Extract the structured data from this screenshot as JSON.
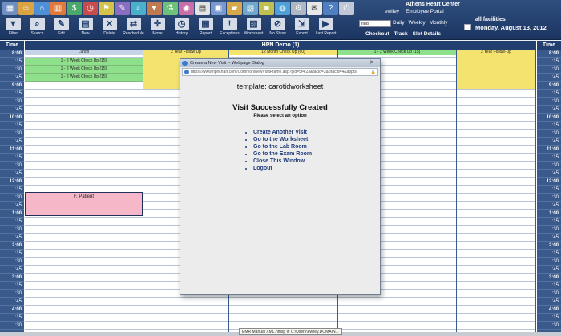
{
  "header": {
    "center_name": "Athens Heart Center",
    "username": "ewiley",
    "portal_link": "Employee Portal",
    "find_value": "find",
    "view_links": [
      "Daily",
      "Weekly",
      "Monthly"
    ],
    "action_links": [
      "Checkout",
      "Track",
      "Slot Details"
    ],
    "facility": "all facilities",
    "date": "Monday, August 13, 2012"
  },
  "top_icons": [
    "calendar-icon",
    "people-icon",
    "home-icon",
    "chart-icon",
    "money-icon",
    "clock-icon",
    "flag-icon",
    "pen-icon",
    "magnify-icon",
    "stethoscope-icon",
    "lab-icon",
    "pill-icon",
    "note-icon",
    "book-icon",
    "folder-icon",
    "photo-icon",
    "camera-icon",
    "globe-icon",
    "gear-icon",
    "mail-icon",
    "help-icon",
    "power-icon"
  ],
  "toolbar": [
    {
      "label": "Filter",
      "glyph": "▼",
      "name": "filter-button"
    },
    {
      "label": "Search",
      "glyph": "⌕",
      "name": "search-button"
    },
    {
      "label": "Edit",
      "glyph": "✎",
      "name": "edit-button"
    },
    {
      "label": "New",
      "glyph": "▤",
      "name": "new-button"
    },
    {
      "label": "Delete",
      "glyph": "✕",
      "name": "delete-button"
    },
    {
      "label": "Reschedule",
      "glyph": "⇄",
      "name": "reschedule-button"
    },
    {
      "label": "Move",
      "glyph": "✛",
      "name": "move-button"
    },
    {
      "label": "History",
      "glyph": "◷",
      "name": "history-button"
    },
    {
      "label": "Report",
      "glyph": "▦",
      "name": "report-button"
    },
    {
      "label": "Exceptions",
      "glyph": "!",
      "name": "exceptions-button"
    },
    {
      "label": "Worksheet",
      "glyph": "▧",
      "name": "worksheet-button"
    },
    {
      "label": "No Show",
      "glyph": "⊘",
      "name": "no-show-button"
    },
    {
      "label": "Export",
      "glyph": "⇲",
      "name": "export-button"
    },
    {
      "label": "Last Report",
      "glyph": "▶",
      "name": "last-report-button"
    }
  ],
  "schedule": {
    "time_header": "Time",
    "provider": "HPN Demo (1)",
    "times": [
      "8:00",
      ":15",
      ":30",
      ":45",
      "9:00",
      ":15",
      ":30",
      ":45",
      "10:00",
      ":15",
      ":30",
      ":45",
      "11:00",
      ":15",
      ":30",
      ":45",
      "12:00",
      ":15",
      ":30",
      ":45",
      "1:00",
      ":15",
      ":30",
      ":45",
      "2:00",
      ":15",
      ":30",
      ":45",
      "3:00",
      ":15",
      ":30",
      ":45",
      "4:00",
      ":15",
      ":30"
    ],
    "columns": [
      {
        "header": "Lunch",
        "header_color": "#c7d3e6"
      },
      {
        "header": "2 Year Follow Up",
        "header_color": "#f4e46f"
      },
      {
        "header": "12 Month Check Up (60)",
        "header_color": "#f4e46f"
      },
      {
        "header": "1 - 2 Week Check Up (15)",
        "header_color": "#8fe08a"
      },
      {
        "header": "2 Year Follow-Up",
        "header_color": "#f4e46f"
      }
    ],
    "left_appointments": [
      "1 - 2 Week Check Up (15)",
      "1 - 2 Week Check Up (15)",
      "1 - 2 Week Check Up (15)"
    ],
    "patient_block": "F. Patient"
  },
  "dialog": {
    "title": "Create a New Visit -- Webpage Dialog",
    "address": "https://www.hpnchart.com/Common/newVisitFrame.asp?pid=5f4f23&facid=2&pracid=4&appts",
    "template_line": "template: carotidworksheet",
    "heading": "Visit Successfully Created",
    "subheading": "Please select an option",
    "options": [
      "Create Another Visit",
      "Go to the Worksheet",
      "Go to the Lab Room",
      "Go to the Exam Room",
      "Close This Window",
      "Logout"
    ]
  },
  "status_tooltip": "EMR Manual XML.hmsp in C:\\Users\\ewiley.DOMAIN..."
}
